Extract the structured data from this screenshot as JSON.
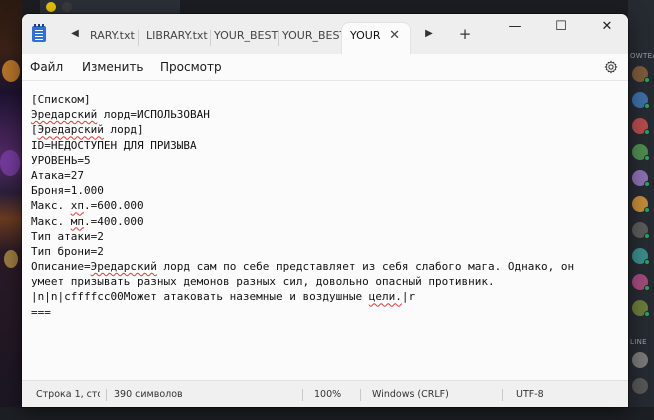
{
  "window": {
    "tabs": [
      {
        "label": "RARY.txt",
        "active": false
      },
      {
        "label": "LIBRARY.txt",
        "active": false
      },
      {
        "label": "YOUR_BESTI",
        "active": false
      },
      {
        "label": "YOUR_BESTI",
        "active": false
      },
      {
        "label": "YOUR",
        "active": true
      }
    ],
    "controls": {
      "minimize": "—",
      "maximize": "☐",
      "close": "✕"
    }
  },
  "menu": {
    "file": "Файл",
    "edit": "Изменить",
    "view": "Просмотр"
  },
  "document": {
    "lines": [
      [
        "[Списком]"
      ],
      [
        "Эредарский",
        " лорд=ИСПОЛЬЗОВАН"
      ],
      [
        "[",
        "Эредарский",
        " лорд]"
      ],
      [
        "ID=НЕДОСТУПЕН ДЛЯ ПРИЗЫВА"
      ],
      [
        "УРОВЕНЬ=5"
      ],
      [
        "Атака=27"
      ],
      [
        "Броня=1.000"
      ],
      [
        "Макс. ",
        "хп",
        ".=600.000"
      ],
      [
        "Макс. ",
        "мп",
        ".=400.000"
      ],
      [
        "Тип атаки=2"
      ],
      [
        "Тип брони=2"
      ],
      [
        "Описание=",
        "Эредарский",
        " лорд сам по себе представляет из себя слабого мага. Однако, он"
      ],
      [
        "умеет призывать разных демонов разных сил, довольно опасный противник."
      ],
      [
        "|n|n|cffffcc00Может атаковать наземные и воздушные ",
        "цели.",
        "|r"
      ],
      [
        "==="
      ]
    ]
  },
  "status": {
    "position": "Строка 1, стол",
    "chars": "390 символов",
    "zoom": "100%",
    "line_endings": "Windows (CRLF)",
    "encoding": "UTF-8"
  },
  "background": {
    "right_panel_header_top": "OWTEA",
    "right_panel_header_bottom": "LINE"
  },
  "colors": {
    "accent": "#2f6fd6",
    "spellcheck": "#d23b3b",
    "online": "#23a559"
  }
}
